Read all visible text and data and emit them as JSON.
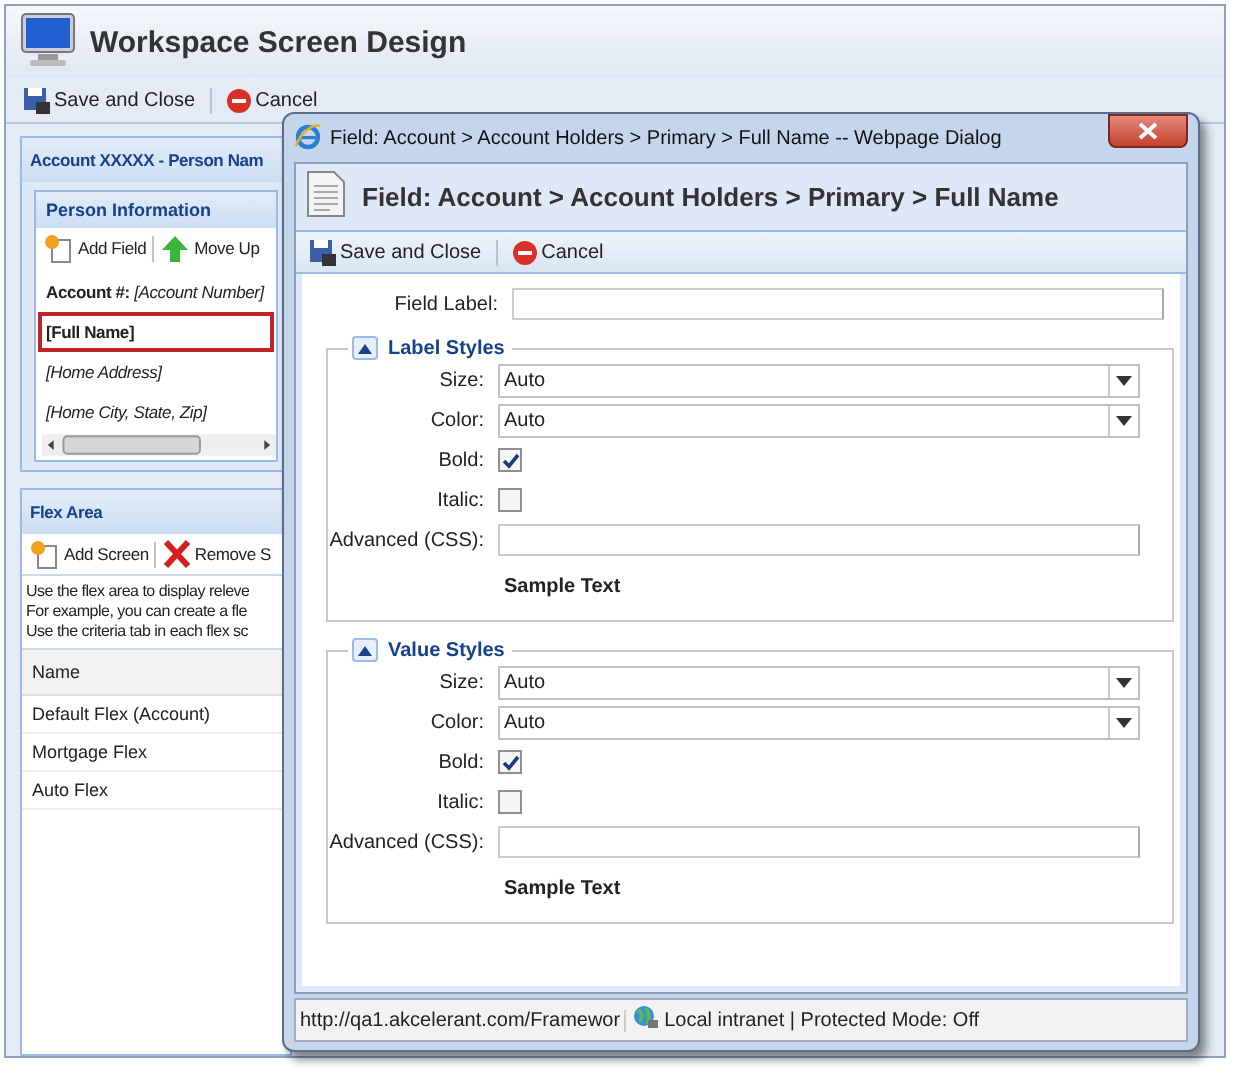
{
  "window": {
    "title": "Workspace Screen Design"
  },
  "toolbar": [
    {
      "label": "Save and Close"
    },
    {
      "label": "Cancel"
    }
  ],
  "account_panel": {
    "title": "Account XXXXX - Person Nam",
    "section": {
      "title": "Person Information",
      "toolbar": [
        {
          "label": "Add Field"
        },
        {
          "label": "Move Up"
        }
      ],
      "fields": [
        {
          "label": "Account #:",
          "value": "[Account Number]",
          "selected": false
        },
        {
          "value": "[Full Name]",
          "selected": true
        },
        {
          "value": "[Home Address]",
          "selected": false
        },
        {
          "value": "[Home City, State, Zip]",
          "selected": false
        }
      ]
    }
  },
  "flex_area": {
    "title": "Flex Area",
    "toolbar": [
      {
        "label": "Add Screen"
      },
      {
        "label": "Remove S"
      }
    ],
    "description": [
      "Use the flex area to display releve",
      "For example, you can create a fle",
      "Use the criteria tab in each flex sc"
    ],
    "columns": [
      "Name"
    ],
    "rows": [
      "Default Flex (Account)",
      "Mortgage Flex",
      "Auto Flex"
    ]
  },
  "dialog": {
    "title": "Field: Account > Account Holders > Primary > Full Name -- Webpage Dialog",
    "heading": "Field: Account > Account Holders > Primary > Full Name",
    "toolbar": [
      {
        "label": "Save and Close"
      },
      {
        "label": "Cancel"
      }
    ],
    "field_label": {
      "label": "Field Label:"
    },
    "sections": [
      {
        "title": "Label Styles",
        "expanded": true,
        "rows": [
          {
            "kind": "select",
            "label": "Size:",
            "value": "Auto"
          },
          {
            "kind": "select",
            "label": "Color:",
            "value": "Auto"
          },
          {
            "kind": "checkbox",
            "label": "Bold:",
            "checked": true
          },
          {
            "kind": "checkbox",
            "label": "Italic:",
            "checked": false
          },
          {
            "kind": "text",
            "label": "Advanced (CSS):"
          }
        ],
        "sample": "Sample Text"
      },
      {
        "title": "Value Styles",
        "expanded": true,
        "rows": [
          {
            "kind": "select",
            "label": "Size:",
            "value": "Auto"
          },
          {
            "kind": "select",
            "label": "Color:",
            "value": "Auto"
          },
          {
            "kind": "checkbox",
            "label": "Bold:",
            "checked": true
          },
          {
            "kind": "checkbox",
            "label": "Italic:",
            "checked": false
          },
          {
            "kind": "text",
            "label": "Advanced (CSS):"
          }
        ],
        "sample": "Sample Text"
      }
    ],
    "status_bar": {
      "url": "http://qa1.akcelerant.com/Framewor",
      "zone": "Local intranet | Protected Mode: Off"
    }
  }
}
